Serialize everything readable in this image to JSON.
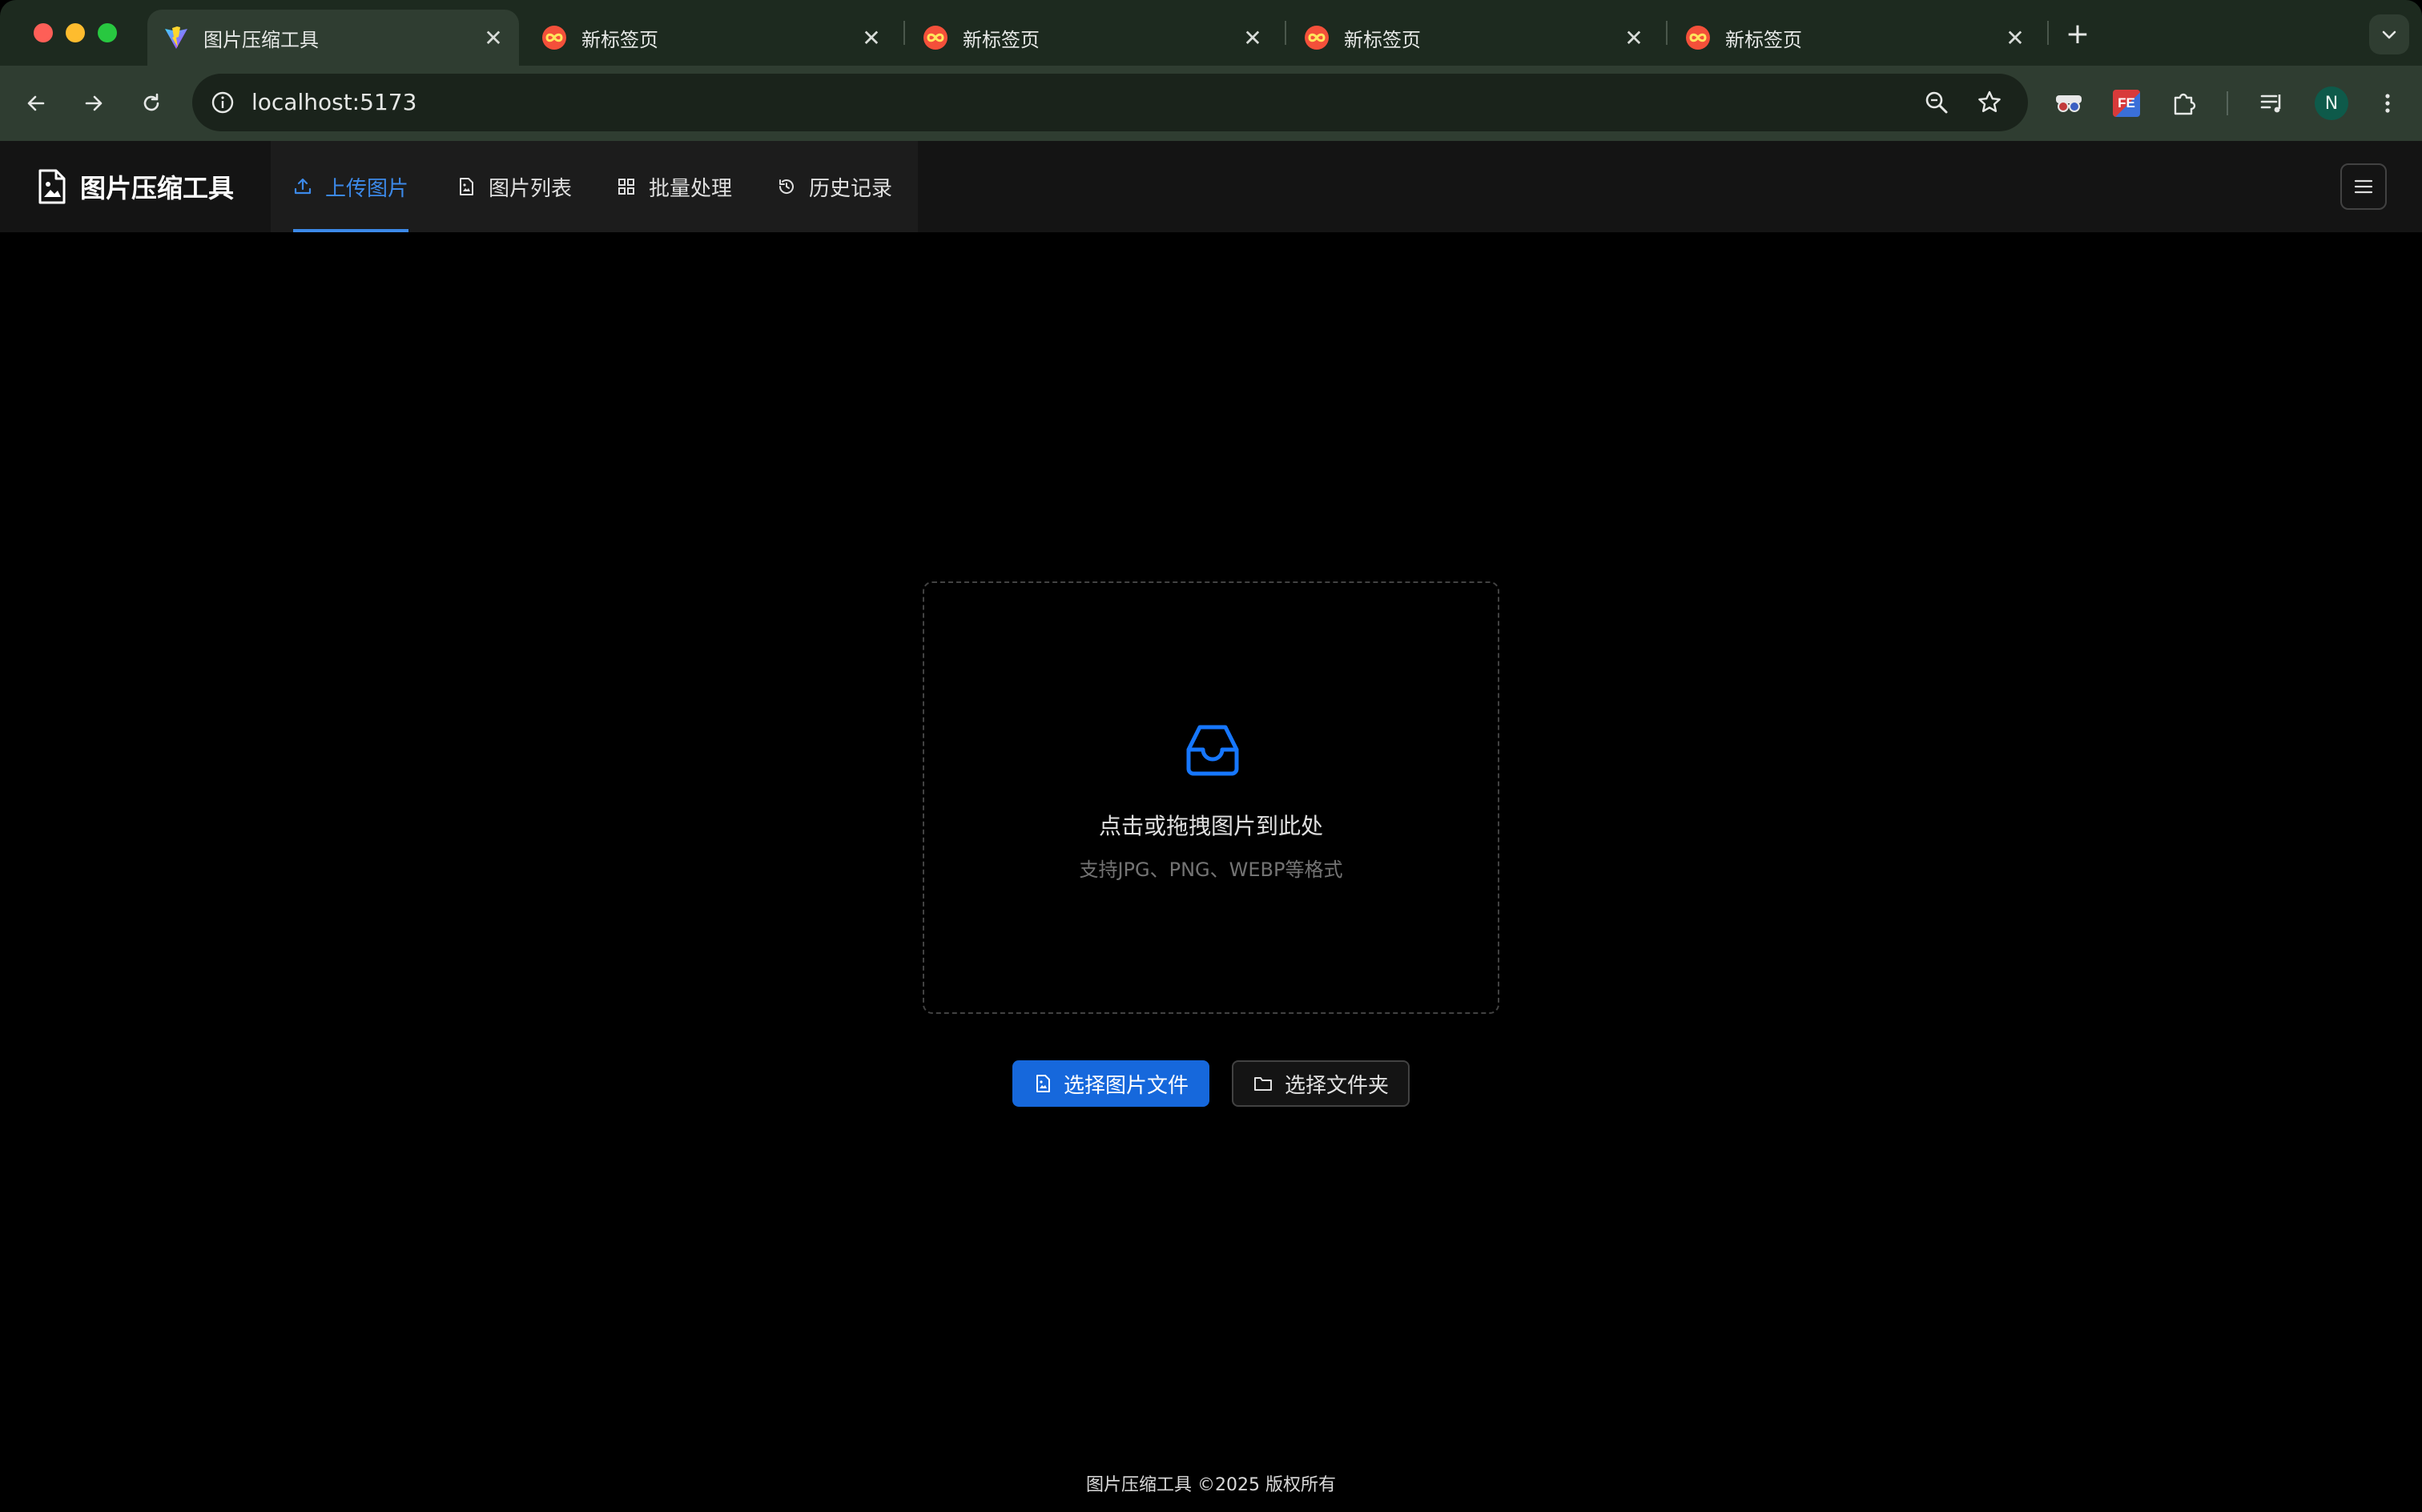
{
  "browser": {
    "tabs": [
      {
        "title": "图片压缩工具",
        "active": true,
        "favicon": "vite-logo-icon"
      },
      {
        "title": "新标签页",
        "active": false,
        "favicon": "infinity-icon"
      },
      {
        "title": "新标签页",
        "active": false,
        "favicon": "infinity-icon"
      },
      {
        "title": "新标签页",
        "active": false,
        "favicon": "infinity-icon"
      },
      {
        "title": "新标签页",
        "active": false,
        "favicon": "infinity-icon"
      }
    ],
    "tab_close_glyph": "✕",
    "new_tab_glyph": "+",
    "address": "localhost:5173",
    "profile_initial": "N",
    "extension_fe_label": "FE"
  },
  "app": {
    "title": "图片压缩工具",
    "nav": [
      {
        "label": "上传图片",
        "icon": "upload-icon",
        "active": true
      },
      {
        "label": "图片列表",
        "icon": "file-image-icon",
        "active": false
      },
      {
        "label": "批量处理",
        "icon": "grid-icon",
        "active": false
      },
      {
        "label": "历史记录",
        "icon": "history-icon",
        "active": false
      }
    ]
  },
  "upload": {
    "drop_title": "点击或拖拽图片到此处",
    "drop_hint": "支持JPG、PNG、WEBP等格式",
    "select_files_label": "选择图片文件",
    "select_folder_label": "选择文件夹"
  },
  "footer": {
    "text": "图片压缩工具 ©2025 版权所有"
  },
  "colors": {
    "accent": "#1668dc",
    "active_nav": "#3c89e8",
    "chrome_frame": "#1d2a1f",
    "chrome_toolbar": "#2f3d31"
  }
}
